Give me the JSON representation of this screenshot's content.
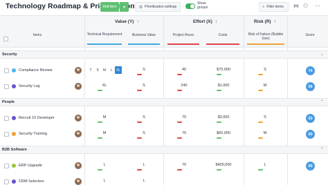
{
  "app": {
    "title": "Technology Roadmap & Prioritization",
    "add_label": "Add item",
    "add_caret": "▾",
    "prioritization_label": "Prioritization settings",
    "show_groups_label": "Show groups",
    "filter_placeholder": "Filter items"
  },
  "header": {
    "items_label": "Items",
    "value_group": "Value (Y)",
    "effort_group": "Effort (X)",
    "risk_group": "Risk (R)",
    "sort_arrow": "↑",
    "columns": {
      "technical_requirement": "Technical Requirement",
      "business_value": "Business Value",
      "project_hours": "Project Hours",
      "costs": "Costs",
      "risk_of_failure": "Risk of Failure (Bubble Size)",
      "score": "Score"
    }
  },
  "colors": {
    "value_accent": "#3ea7e0",
    "effort_accent": "#e04545",
    "risk_accent": "#f0a23a",
    "score_blue": "#4a9be0"
  },
  "picker_options": [
    "T",
    "S",
    "M",
    "L",
    "XL"
  ],
  "picker_selected": "XL",
  "sections": [
    {
      "label": "Security",
      "caret": "⌄",
      "rows": [
        {
          "name": "Compliance Review",
          "dot_color": "#4ab3e8",
          "tech": "",
          "business": "S",
          "hours": "40",
          "costs": "$70,000",
          "risk": "S",
          "score": "74",
          "risk_bar": "#f0a23a"
        },
        {
          "name": "Security Log",
          "dot_color": "#6a4fd0",
          "tech": "XL",
          "business": "S",
          "hours": "240",
          "costs": "$1,000",
          "risk": "M",
          "score": "56",
          "risk_bar": "#f0a23a"
        }
      ]
    },
    {
      "label": "People",
      "caret": "⌃",
      "rows": [
        {
          "name": "Recruit 10 Developer",
          "dot_color": "#6a4fd0",
          "tech": "M",
          "business": "S",
          "hours": "70",
          "costs": "$3,000",
          "risk": "S",
          "score": "53",
          "risk_bar": "#f0a23a"
        },
        {
          "name": "Security Training",
          "dot_color": "#f0a23a",
          "tech": "M",
          "business": "S",
          "hours": "70",
          "costs": "$60,000",
          "risk": "M",
          "score": "50",
          "risk_bar": "#f0a23a"
        }
      ]
    },
    {
      "label": "B2B Software",
      "caret": "⌃",
      "rows": [
        {
          "name": "ERP Upgrade",
          "dot_color": "#9bc53d",
          "tech": "L",
          "business": "L",
          "hours": "70",
          "costs": "$400,000",
          "risk": "L",
          "score": "55",
          "risk_bar": "#5fbf72"
        },
        {
          "name": "CRM Selection",
          "dot_color": "#6a4fd0",
          "tech": "L",
          "business": "L",
          "hours": "",
          "costs": "",
          "risk": "",
          "score": "",
          "risk_bar": "#5fbf72"
        }
      ]
    }
  ]
}
